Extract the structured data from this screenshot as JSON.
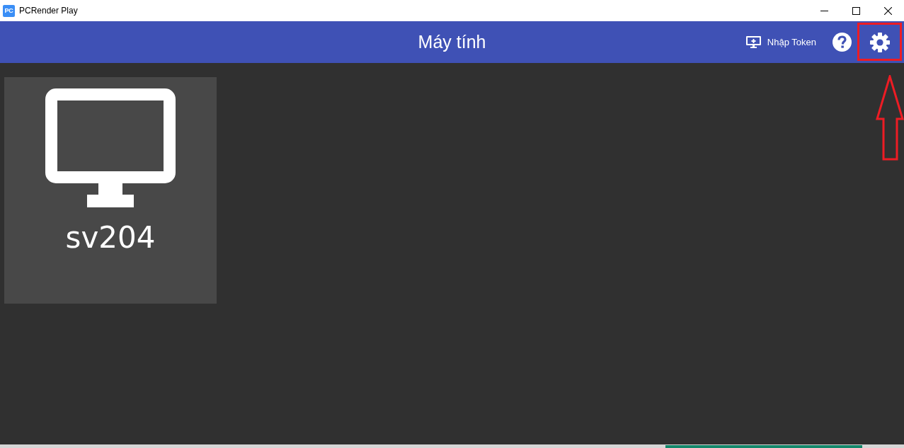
{
  "window": {
    "logo_text": "PC",
    "title": "PCRender Play"
  },
  "header": {
    "title": "Máy tính",
    "token_button": "Nhập Token"
  },
  "computers": [
    {
      "name": "sv204"
    }
  ]
}
